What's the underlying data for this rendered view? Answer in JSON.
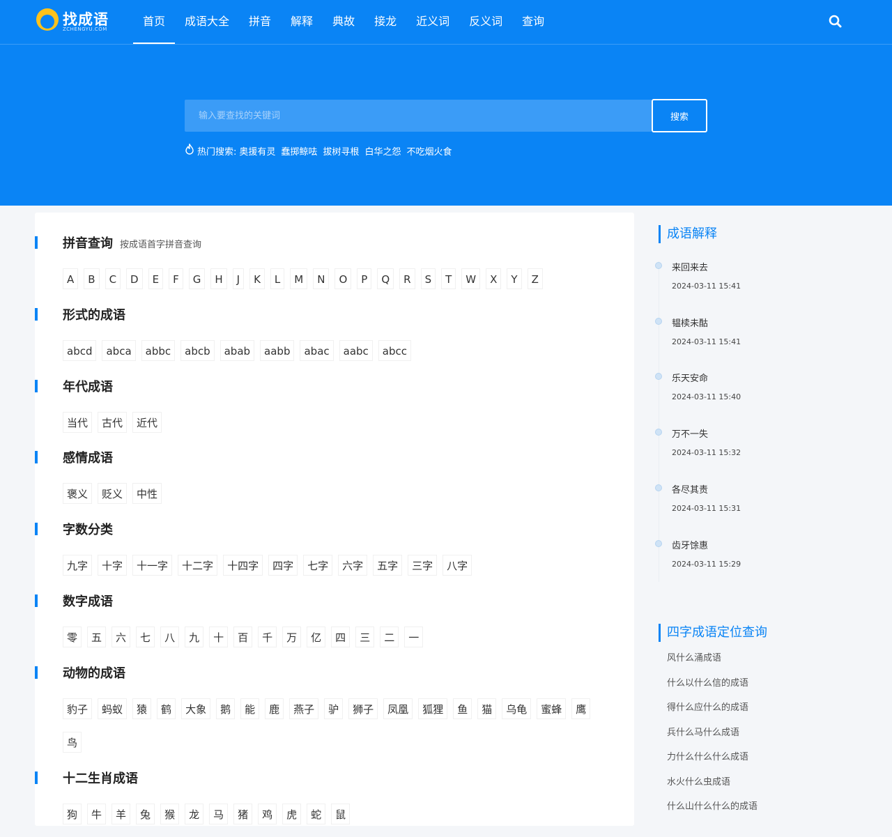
{
  "logo": {
    "text": "找成语",
    "sub": "ZCHENGYU.COM"
  },
  "nav": [
    "首页",
    "成语大全",
    "拼音",
    "解释",
    "典故",
    "接龙",
    "近义词",
    "反义词",
    "查询"
  ],
  "header_search_icon": "search-icon",
  "search": {
    "placeholder": "输入要查找的关键词",
    "button": "搜索"
  },
  "hot": {
    "icon": "flame-icon",
    "label": "热门搜索:",
    "links": [
      "奥援有灵",
      "蠢掷鲸呿",
      "拔树寻根",
      "白华之怨",
      "不吃烟火食"
    ]
  },
  "sections": [
    {
      "title": "拼音查询",
      "subtitle": "按成语首字拼音查询",
      "tags": [
        "A",
        "B",
        "C",
        "D",
        "E",
        "F",
        "G",
        "H",
        "J",
        "K",
        "L",
        "M",
        "N",
        "O",
        "P",
        "Q",
        "R",
        "S",
        "T",
        "W",
        "X",
        "Y",
        "Z"
      ]
    },
    {
      "title": "形式的成语",
      "tags": [
        "abcd",
        "abca",
        "abbc",
        "abcb",
        "abab",
        "aabb",
        "abac",
        "aabc",
        "abcc"
      ]
    },
    {
      "title": "年代成语",
      "tags": [
        "当代",
        "古代",
        "近代"
      ]
    },
    {
      "title": "感情成语",
      "tags": [
        "褒义",
        "贬义",
        "中性"
      ]
    },
    {
      "title": "字数分类",
      "tags": [
        "九字",
        "十字",
        "十一字",
        "十二字",
        "十四字",
        "四字",
        "七字",
        "六字",
        "五字",
        "三字",
        "八字"
      ]
    },
    {
      "title": "数字成语",
      "tags": [
        "零",
        "五",
        "六",
        "七",
        "八",
        "九",
        "十",
        "百",
        "千",
        "万",
        "亿",
        "四",
        "三",
        "二",
        "一"
      ]
    },
    {
      "title": "动物的成语",
      "tags": [
        "豹子",
        "蚂蚁",
        "猿",
        "鹤",
        "大象",
        "鹅",
        "能",
        "鹿",
        "燕子",
        "驴",
        "狮子",
        "凤凰",
        "狐狸",
        "鱼",
        "猫",
        "乌龟",
        "蜜蜂",
        "鹰",
        "鸟"
      ]
    },
    {
      "title": "十二生肖成语",
      "tags": [
        "狗",
        "牛",
        "羊",
        "兔",
        "猴",
        "龙",
        "马",
        "猪",
        "鸡",
        "虎",
        "蛇",
        "鼠"
      ]
    }
  ],
  "sidebar": {
    "explain_title": "成语解释",
    "explain_items": [
      {
        "title": "来回来去",
        "date": "2024-03-11 15:41"
      },
      {
        "title": "韫椟未酤",
        "date": "2024-03-11 15:41"
      },
      {
        "title": "乐天安命",
        "date": "2024-03-11 15:40"
      },
      {
        "title": "万不一失",
        "date": "2024-03-11 15:32"
      },
      {
        "title": "各尽其责",
        "date": "2024-03-11 15:31"
      },
      {
        "title": "齿牙馀惠",
        "date": "2024-03-11 15:29"
      }
    ],
    "position_title": "四字成语定位查询",
    "position_items": [
      "风什么涌成语",
      "什么以什么信的成语",
      "得什么应什么的成语",
      "兵什么马什么成语",
      "力什么什么什么成语",
      "水火什么虫成语",
      "什么山什么什么的成语"
    ]
  },
  "colors": {
    "primary": "#0a84f5",
    "page_bg": "#f4f6f9"
  }
}
